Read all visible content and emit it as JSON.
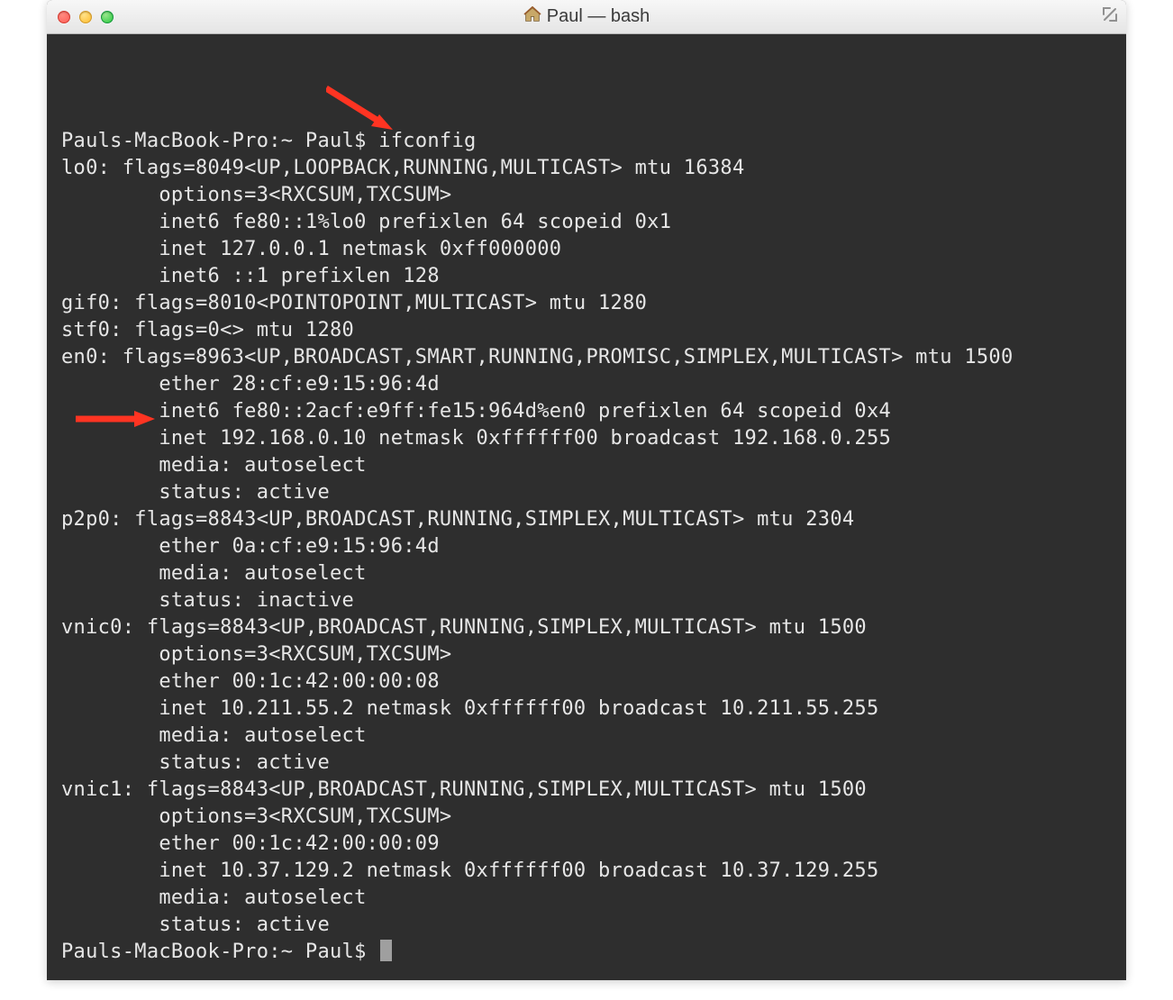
{
  "window": {
    "title": "Paul — bash"
  },
  "terminal": {
    "prompt1": "Pauls-MacBook-Pro:~ Paul$ ",
    "command": "ifconfig",
    "lines": [
      "lo0: flags=8049<UP,LOOPBACK,RUNNING,MULTICAST> mtu 16384",
      "        options=3<RXCSUM,TXCSUM>",
      "        inet6 fe80::1%lo0 prefixlen 64 scopeid 0x1",
      "        inet 127.0.0.1 netmask 0xff000000",
      "        inet6 ::1 prefixlen 128",
      "gif0: flags=8010<POINTOPOINT,MULTICAST> mtu 1280",
      "stf0: flags=0<> mtu 1280",
      "en0: flags=8963<UP,BROADCAST,SMART,RUNNING,PROMISC,SIMPLEX,MULTICAST> mtu 1500",
      "        ether 28:cf:e9:15:96:4d",
      "        inet6 fe80::2acf:e9ff:fe15:964d%en0 prefixlen 64 scopeid 0x4",
      "        inet 192.168.0.10 netmask 0xffffff00 broadcast 192.168.0.255",
      "        media: autoselect",
      "        status: active",
      "p2p0: flags=8843<UP,BROADCAST,RUNNING,SIMPLEX,MULTICAST> mtu 2304",
      "        ether 0a:cf:e9:15:96:4d",
      "        media: autoselect",
      "        status: inactive",
      "vnic0: flags=8843<UP,BROADCAST,RUNNING,SIMPLEX,MULTICAST> mtu 1500",
      "        options=3<RXCSUM,TXCSUM>",
      "        ether 00:1c:42:00:00:08",
      "        inet 10.211.55.2 netmask 0xffffff00 broadcast 10.211.55.255",
      "        media: autoselect",
      "        status: active",
      "vnic1: flags=8843<UP,BROADCAST,RUNNING,SIMPLEX,MULTICAST> mtu 1500",
      "        options=3<RXCSUM,TXCSUM>",
      "        ether 00:1c:42:00:00:09",
      "        inet 10.37.129.2 netmask 0xffffff00 broadcast 10.37.129.255",
      "        media: autoselect",
      "        status: active"
    ],
    "prompt2": "Pauls-MacBook-Pro:~ Paul$ "
  },
  "annotations": {
    "arrow_color": "#ff3422"
  }
}
